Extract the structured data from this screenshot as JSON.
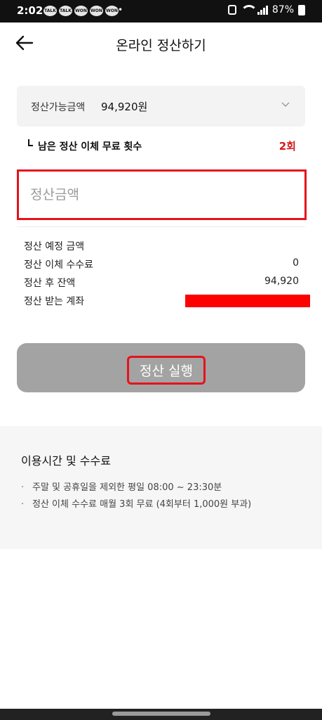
{
  "status_bar": {
    "time": "2:02",
    "notif_icons": [
      "TALK",
      "TALK",
      "WON",
      "WON",
      "WON"
    ],
    "bullet": "•",
    "battery": "87%"
  },
  "header": {
    "title": "온라인 정산하기",
    "back_icon": "arrow-left-icon"
  },
  "settlement_select": {
    "label": "정산가능금액",
    "value": "94,920원",
    "icon": "chevron-down-icon"
  },
  "free_transfer": {
    "label": "남은 정산 이체 무료 횟수",
    "count": "2회",
    "count_color": "#d21a1a"
  },
  "amount_input": {
    "placeholder": "정산금액",
    "value": ""
  },
  "summary": {
    "expected_label": "정산 예정 금액",
    "expected_value": "",
    "fee_label": "정산 이체 수수료",
    "fee_value": "0",
    "balance_label": "정산 후 잔액",
    "balance_value": "94,920",
    "account_label": "정산 받는 계좌"
  },
  "execute_button": {
    "label": "정산 실행"
  },
  "info": {
    "title": "이용시간 및 수수료",
    "items": [
      "주말 및 공휴일을 제외한 평일 08:00 ~ 23:30분",
      "정산 이체 수수료 매월 3회 무료 (4회부터 1,000원 부과)"
    ]
  },
  "colors": {
    "accent_red": "#e4131c",
    "button_disabled": "#a3a3a3"
  }
}
